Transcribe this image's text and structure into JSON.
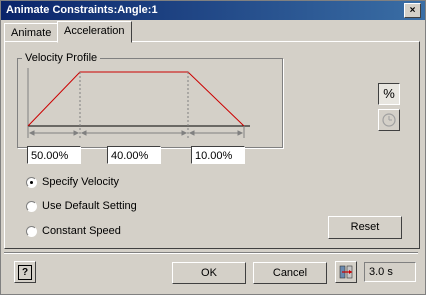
{
  "window": {
    "title": "Animate Constraints:Angle:1",
    "close_label": "×"
  },
  "tabs": [
    {
      "label": "Animate"
    },
    {
      "label": "Acceleration"
    }
  ],
  "profile": {
    "group_label": "Velocity Profile",
    "segments": [
      "50.00%",
      "40.00%",
      "10.00%"
    ]
  },
  "options": {
    "specify_velocity": "Specify Velocity",
    "use_default": "Use Default Setting",
    "constant_speed": "Constant Speed",
    "selected": "specify_velocity"
  },
  "side_buttons": {
    "percent_label": "%"
  },
  "buttons": {
    "reset": "Reset",
    "ok": "OK",
    "cancel": "Cancel",
    "help": "?"
  },
  "status": {
    "duration": "3.0 s"
  },
  "colors": {
    "profile_line": "#cc0000",
    "titlebar": "#0a246a"
  }
}
